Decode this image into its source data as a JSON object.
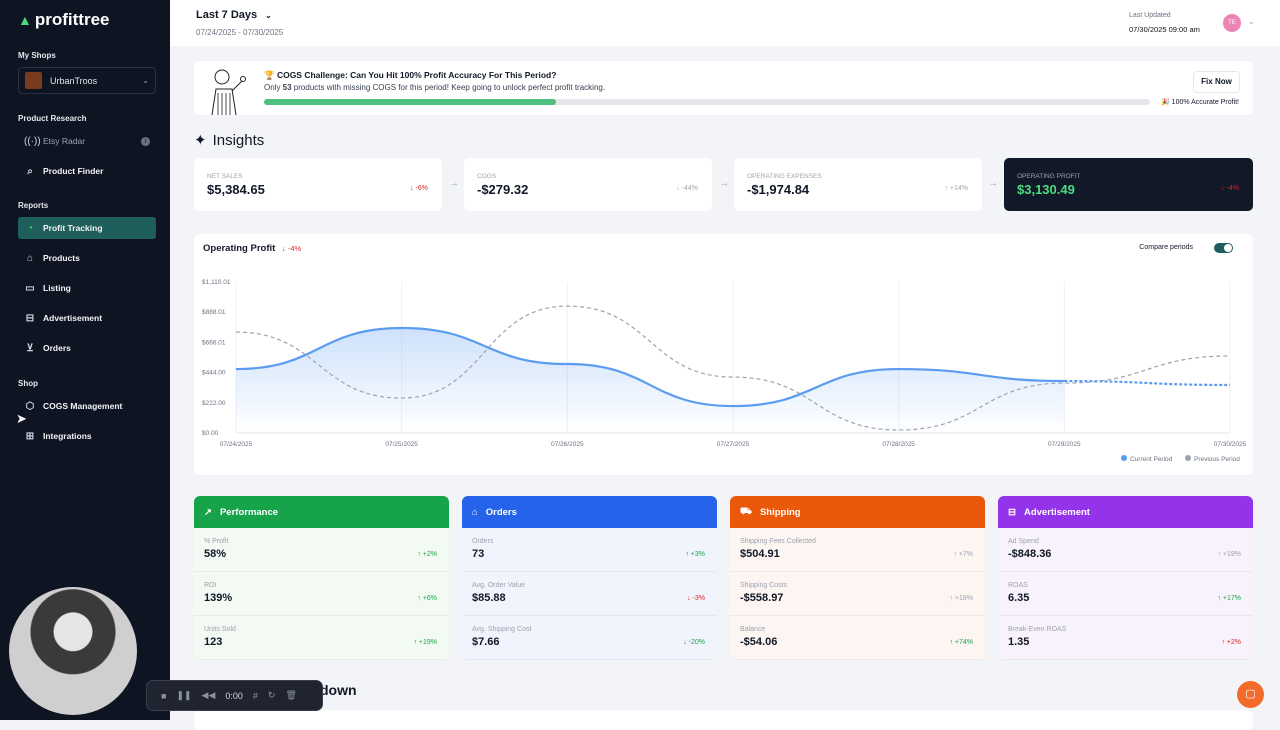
{
  "sidebar": {
    "logo": "profittree",
    "my_shops_label": "My Shops",
    "shop_name": "UrbanTroos",
    "product_research_label": "Product Research",
    "research_items": [
      {
        "label": "Etsy Radar",
        "icon": "radar-icon"
      },
      {
        "label": "Product Finder",
        "icon": "search-icon"
      }
    ],
    "reports_label": "Reports",
    "reports_items": [
      {
        "label": "Profit Tracking",
        "icon": "pie-chart-icon",
        "active": true
      },
      {
        "label": "Products",
        "icon": "bag-icon"
      },
      {
        "label": "Listing",
        "icon": "listing-icon"
      },
      {
        "label": "Advertisement",
        "icon": "ads-icon"
      },
      {
        "label": "Orders",
        "icon": "cart-icon"
      }
    ],
    "shop_label": "Shop",
    "shop_items": [
      {
        "label": "COGS Management",
        "icon": "box-icon"
      },
      {
        "label": "Integrations",
        "icon": "grid-icon"
      }
    ]
  },
  "header": {
    "period": "Last 7 Days",
    "range": "07/24/2025 - 07/30/2025",
    "last_updated_label": "Last Updated",
    "last_updated": "07/30/2025 09:00 am",
    "avatar_initials": "TE"
  },
  "banner": {
    "title": "🏆 COGS Challenge: Can You Hit 100% Profit Accuracy For This Period?",
    "sub_pre": "Only ",
    "count": "53",
    "sub_post": " products with missing COGS for this period! Keep going to unlock perfect profit tracking.",
    "progress_percent": 33,
    "fix_label": "Fix Now",
    "goal": "🎉 100% Accurate Profit!"
  },
  "insights_title": "Insights",
  "kpis": [
    {
      "label": "NET SALES",
      "value": "$5,384.65",
      "change": "↓ -6%",
      "tone": "red"
    },
    {
      "label": "COGS",
      "value": "-$279.32",
      "change": "↓ -44%",
      "tone": "grey"
    },
    {
      "label": "OPERATING EXPENSES",
      "value": "-$1,974.84",
      "change": "↑ +14%",
      "tone": "grey"
    },
    {
      "label": "OPERATING PROFIT",
      "value": "$3,130.49",
      "change": "↓ -4%",
      "tone": "red"
    }
  ],
  "chart_card": {
    "title": "Operating Profit",
    "change": "↓ -4%",
    "compare_label": "Compare periods",
    "compare_on": true
  },
  "chart_data": {
    "type": "line",
    "x": [
      "07/24/2025",
      "07/25/2025",
      "07/26/2025",
      "07/27/2025",
      "07/28/2025",
      "07/29/2025",
      "07/30/2025"
    ],
    "y_ticks": [
      "$0.00",
      "$222.00",
      "$444.00",
      "$666.01",
      "$888.01",
      "$1,110.01"
    ],
    "ylim": [
      0,
      1110.01
    ],
    "grid": "vertical",
    "legend": "bottom-right",
    "series": [
      {
        "name": "Current Period",
        "color": "#5b9cf0",
        "values": [
          470,
          772,
          507,
          198,
          470,
          382,
          353
        ]
      },
      {
        "name": "Previous Period",
        "color": "#9ca3af",
        "values": [
          742,
          257,
          933,
          411,
          22,
          367,
          566
        ]
      }
    ]
  },
  "groups": [
    {
      "title": "Performance",
      "icon": "trend-up-icon",
      "color": "#16a34a",
      "bg": "#f3f9f3",
      "rows": [
        {
          "label": "% Profit",
          "value": "58%",
          "change": "↑ +2%",
          "tone": "green"
        },
        {
          "label": "ROI",
          "value": "139%",
          "change": "↑ +6%",
          "tone": "green"
        },
        {
          "label": "Units Sold",
          "value": "123",
          "change": "↑ +19%",
          "tone": "green"
        }
      ]
    },
    {
      "title": "Orders",
      "icon": "bag-icon",
      "color": "#2563eb",
      "bg": "#f1f4fc",
      "rows": [
        {
          "label": "Orders",
          "value": "73",
          "change": "↑ +3%",
          "tone": "green"
        },
        {
          "label": "Avg. Order Value",
          "value": "$85.88",
          "change": "↓ -3%",
          "tone": "red"
        },
        {
          "label": "Avg. Shipping Cost",
          "value": "$7.66",
          "change": "↓ -20%",
          "tone": "green"
        }
      ]
    },
    {
      "title": "Shipping",
      "icon": "truck-icon",
      "color": "#ea580c",
      "bg": "#fcf5f1",
      "rows": [
        {
          "label": "Shipping Fees Collected",
          "value": "$504.91",
          "change": "↑ +7%",
          "tone": "grey"
        },
        {
          "label": "Shipping Costs",
          "value": "-$558.97",
          "change": "↑ +18%",
          "tone": "grey"
        },
        {
          "label": "Balance",
          "value": "-$54.06",
          "change": "↑ +74%",
          "tone": "green"
        }
      ]
    },
    {
      "title": "Advertisement",
      "icon": "ads-icon",
      "color": "#9333ea",
      "bg": "#f8f2fc",
      "rows": [
        {
          "label": "Ad Spend",
          "value": "-$848.36",
          "change": "↑ +19%",
          "tone": "grey"
        },
        {
          "label": "ROAS",
          "value": "6.35",
          "change": "↑ +17%",
          "tone": "green"
        },
        {
          "label": "Break-Even ROAS",
          "value": "1.35",
          "change": "↑ +2%",
          "tone": "red"
        }
      ]
    }
  ],
  "breakdown_title": "down",
  "recorder": {
    "time": "0:00"
  }
}
